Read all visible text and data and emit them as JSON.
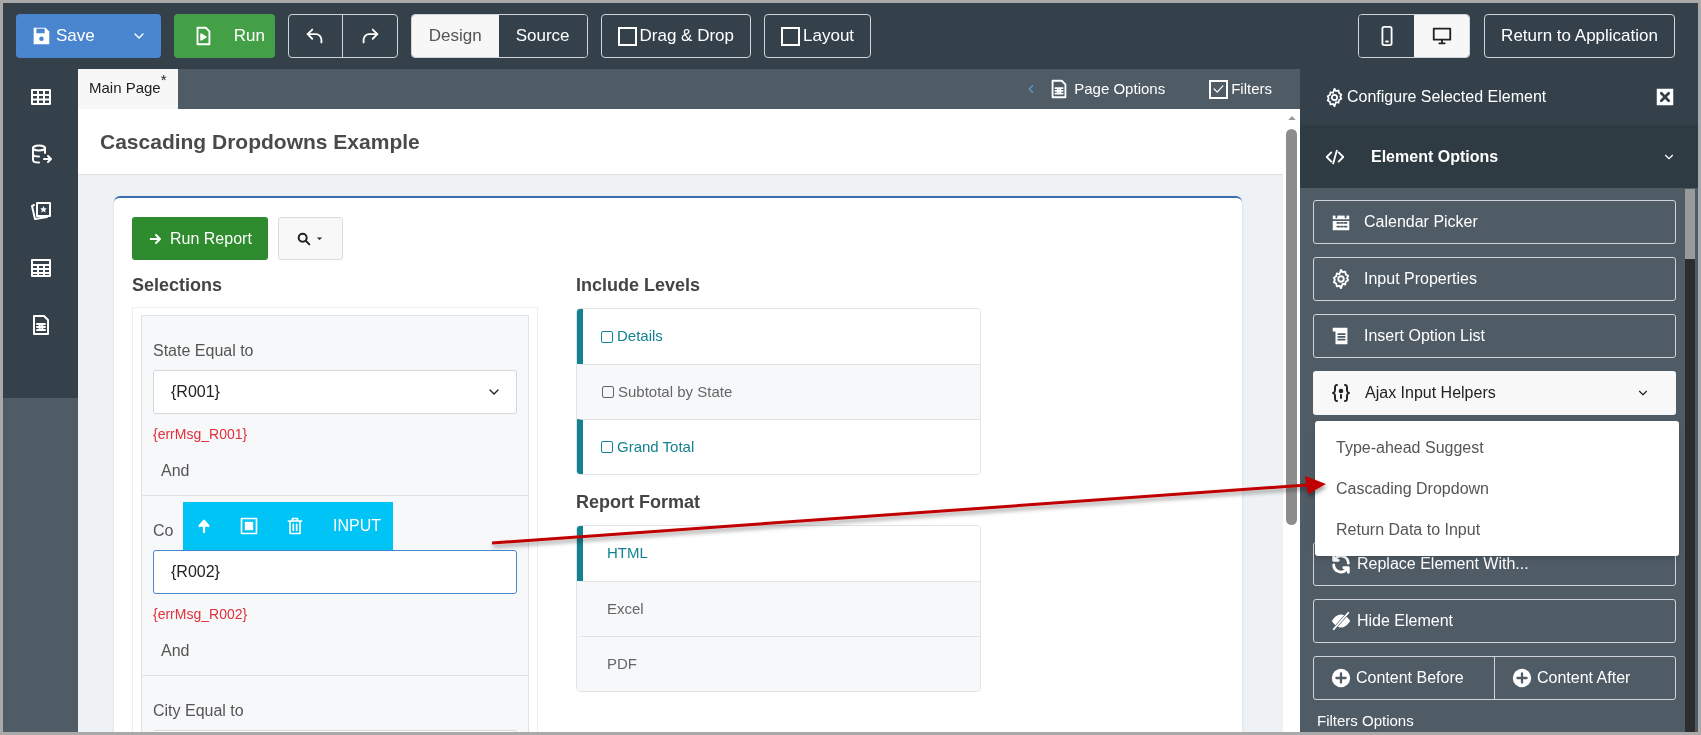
{
  "toolbar": {
    "save": {
      "label": "Save"
    },
    "run": {
      "label": "Run"
    },
    "view_tabs": [
      {
        "label": "Design",
        "selected": true
      },
      {
        "label": "Source",
        "selected": false
      }
    ],
    "toggles": [
      {
        "label": "Drag & Drop",
        "checked": false
      },
      {
        "label": "Layout",
        "checked": false
      }
    ],
    "devices": [
      {
        "kind": "phone",
        "selected": false
      },
      {
        "kind": "desktop",
        "selected": true
      }
    ],
    "return_button": "Return to Application"
  },
  "page_tabs": [
    {
      "label": "Main Page",
      "mark": "*",
      "selected": true
    }
  ],
  "page_options": "Page Options",
  "filters_toggle": {
    "label": "Filters",
    "checked": true
  },
  "page_title": "Cascading Dropdowns Example",
  "report": {
    "run_button": "Run Report",
    "selections_heading": "Selections",
    "filters": [
      {
        "kind": "select",
        "label": "State Equal to",
        "value": "{R001}",
        "error": "{errMsg_R001}",
        "conjunction": "And",
        "focused": false
      },
      {
        "kind": "input",
        "label": "Co",
        "value": "{R002}",
        "error": "{errMsg_R002}",
        "conjunction": "And",
        "focused": true
      },
      {
        "kind": "input",
        "label": "City Equal to"
      }
    ],
    "element_toolbar": {
      "label": "INPUT"
    },
    "include_levels": {
      "heading": "Include Levels",
      "items": [
        {
          "label": "Details",
          "selected": true
        },
        {
          "label": "Subtotal by State",
          "selected": false
        },
        {
          "label": "Grand Total",
          "selected": true
        }
      ]
    },
    "report_format": {
      "heading": "Report Format",
      "items": [
        {
          "label": "HTML",
          "selected": true
        },
        {
          "label": "Excel",
          "selected": false
        },
        {
          "label": "PDF",
          "selected": false
        }
      ]
    }
  },
  "panel": {
    "title": "Configure Selected Element",
    "section": {
      "label": "Element Options",
      "expanded": true
    },
    "buttons": [
      {
        "kind": "calendar",
        "label": "Calendar Picker"
      },
      {
        "kind": "gear",
        "label": "Input Properties"
      },
      {
        "kind": "list",
        "label": "Insert Option List"
      }
    ],
    "ajax": {
      "label": "Ajax Input Helpers",
      "expanded": true,
      "items": [
        "Type-ahead Suggest",
        "Cascading Dropdown",
        "Return Data to Input"
      ]
    },
    "lower_buttons": [
      {
        "kind": "refresh",
        "label": "Replace Element With..."
      },
      {
        "kind": "hide",
        "label": "Hide Element"
      }
    ],
    "content_buttons": [
      "Content Before",
      "Content After"
    ],
    "footer": "Filters Options"
  }
}
